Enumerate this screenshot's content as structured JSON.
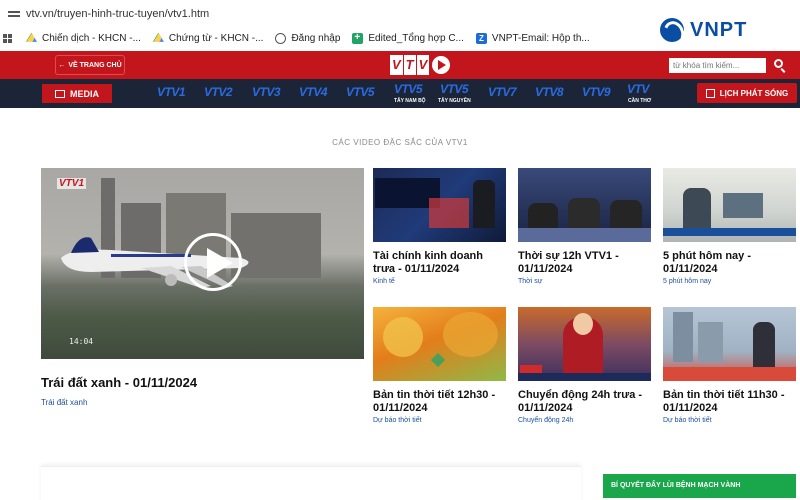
{
  "browser": {
    "url": "vtv.vn/truyen-hinh-truc-tuyen/vtv1.htm",
    "bookmarks": [
      {
        "label": "Chiến dịch - KHCN -...",
        "icon": "drive-icon"
      },
      {
        "label": "Chứng từ - KHCN -...",
        "icon": "drive-icon"
      },
      {
        "label": "Đăng nhập",
        "icon": "globe-icon"
      },
      {
        "label": "Edited_Tổng hợp C...",
        "icon": "sheets-icon"
      },
      {
        "label": "VNPT-Email: Hộp th...",
        "icon": "z-icon"
      }
    ]
  },
  "overlay_logo": {
    "text": "VNPT"
  },
  "header": {
    "home_label": "VỀ TRANG CHỦ",
    "logo_text": [
      "V",
      "T",
      "V"
    ],
    "search_placeholder": "từ khóa tìm kiếm...",
    "media_label": "MEDIA",
    "schedule_label": "LỊCH PHÁT SÓNG",
    "channels": [
      {
        "label": "VTV1",
        "sub": ""
      },
      {
        "label": "VTV2",
        "sub": ""
      },
      {
        "label": "VTV3",
        "sub": ""
      },
      {
        "label": "VTV4",
        "sub": ""
      },
      {
        "label": "VTV5",
        "sub": ""
      },
      {
        "label": "VTV5",
        "sub": "TÂY NAM BỘ"
      },
      {
        "label": "VTV5",
        "sub": "TÂY NGUYÊN"
      },
      {
        "label": "VTV7",
        "sub": ""
      },
      {
        "label": "VTV8",
        "sub": ""
      },
      {
        "label": "VTV9",
        "sub": ""
      },
      {
        "label": "VTV",
        "sub": "CẦN THƠ"
      }
    ]
  },
  "section": {
    "title": "CÁC VIDEO ĐẶC SẮC CỦA VTV1"
  },
  "featured": {
    "title": "Trái đất xanh - 01/11/2024",
    "category": "Trái đất xanh",
    "timecode": "14:04",
    "badge": "VTV1"
  },
  "cards": [
    {
      "title": "Tài chính kinh doanh trưa - 01/11/2024",
      "category": "Kinh tế"
    },
    {
      "title": "Thời sự 12h VTV1 - 01/11/2024",
      "category": "Thời sự"
    },
    {
      "title": "5 phút hôm nay - 01/11/2024",
      "category": "5 phút hôm nay"
    },
    {
      "title": "Bản tin thời tiết 12h30 - 01/11/2024",
      "category": "Dự báo thời tiết"
    },
    {
      "title": "Chuyển động 24h trưa - 01/11/2024",
      "category": "Chuyển động 24h"
    },
    {
      "title": "Bản tin thời tiết 11h30 - 01/11/2024",
      "category": "Dự báo thời tiết"
    }
  ],
  "promo": {
    "label": "BÍ QUYẾT ĐẨY LÙI BỆNH MẠCH VÀNH"
  }
}
